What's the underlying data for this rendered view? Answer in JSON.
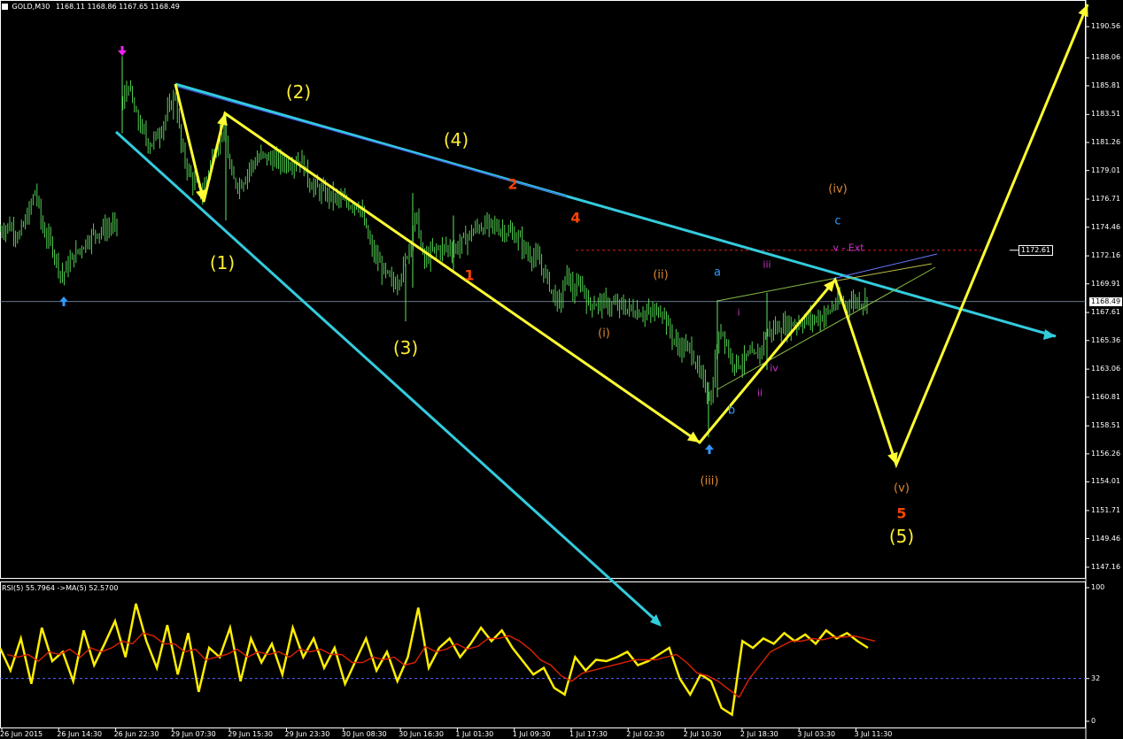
{
  "header": {
    "symbol": "GOLD,M30",
    "ohlc": "1168.11 1168.86 1167.65 1168.49",
    "rsi_title": "RSI(5) 55.7964 ->MA(5) 52.5700"
  },
  "colors": {
    "background": "#000000",
    "candle": "#5ce65c",
    "wave_yellow": "#ffff33",
    "trendline_cyan": "#33ccdd",
    "wave_red": "#ff4400",
    "wave_orange": "#dd8833",
    "wave_blue": "#3399ff",
    "wave_magenta": "#cc33cc",
    "rsi": "#ffee00",
    "rsi_ma": "#dd2200",
    "grid": "#ffffff"
  },
  "chart_data": [
    {
      "type": "candlestick",
      "title": "GOLD,M30",
      "ylim": [
        1146.3,
        1192.7
      ],
      "y_ticks": [
        "1190.56",
        "1188.06",
        "1185.81",
        "1183.51",
        "1181.26",
        "1179.01",
        "1176.71",
        "1174.46",
        "1172.16",
        "1169.91",
        "1167.61",
        "1165.36",
        "1163.06",
        "1160.81",
        "1158.51",
        "1156.26",
        "1154.01",
        "1151.71",
        "1149.46",
        "1147.16"
      ],
      "x_ticks": [
        "26 Jun 2015",
        "26 Jun 14:30",
        "26 Jun 22:30",
        "29 Jun 07:30",
        "29 Jun 15:30",
        "29 Jun 23:30",
        "30 Jun 08:30",
        "30 Jun 16:30",
        "1 Jul 01:30",
        "1 Jul 09:30",
        "1 Jul 17:30",
        "2 Jul 02:30",
        "2 Jul 10:30",
        "2 Jul 18:30",
        "3 Jul 03:30",
        "3 Jul 11:30"
      ],
      "close_path": [
        [
          0,
          1174.2
        ],
        [
          10,
          1174.6
        ],
        [
          22,
          1173.8
        ],
        [
          32,
          1175.5
        ],
        [
          40,
          1177.5
        ],
        [
          48,
          1174.3
        ],
        [
          58,
          1173.1
        ],
        [
          70,
          1170.5
        ],
        [
          80,
          1171.8
        ],
        [
          92,
          1172.9
        ],
        [
          106,
          1174.0
        ],
        [
          122,
          1174.4
        ],
        [
          134,
          1174.7
        ],
        [
          138,
          1184.2
        ],
        [
          145,
          1186.0
        ],
        [
          152,
          1183.6
        ],
        [
          160,
          1182.3
        ],
        [
          168,
          1181.1
        ],
        [
          178,
          1181.8
        ],
        [
          190,
          1183.8
        ],
        [
          198,
          1185.1
        ],
        [
          205,
          1180.7
        ],
        [
          215,
          1178.5
        ],
        [
          228,
          1177.1
        ],
        [
          240,
          1180.2
        ],
        [
          252,
          1182.6
        ],
        [
          262,
          1178.2
        ],
        [
          272,
          1177.9
        ],
        [
          282,
          1179.3
        ],
        [
          295,
          1180.2
        ],
        [
          310,
          1179.8
        ],
        [
          325,
          1179.6
        ],
        [
          340,
          1179.9
        ],
        [
          350,
          1178.0
        ],
        [
          362,
          1177.3
        ],
        [
          375,
          1176.9
        ],
        [
          390,
          1176.4
        ],
        [
          405,
          1176.3
        ],
        [
          420,
          1172.6
        ],
        [
          432,
          1171.0
        ],
        [
          445,
          1169.8
        ],
        [
          455,
          1171.1
        ],
        [
          462,
          1173.0
        ],
        [
          470,
          1175.5
        ],
        [
          478,
          1171.7
        ],
        [
          490,
          1172.6
        ],
        [
          502,
          1172.8
        ],
        [
          515,
          1172.8
        ],
        [
          525,
          1173.5
        ],
        [
          540,
          1174.5
        ],
        [
          555,
          1174.6
        ],
        [
          570,
          1174.2
        ],
        [
          585,
          1173.6
        ],
        [
          595,
          1172.4
        ],
        [
          605,
          1172.0
        ],
        [
          615,
          1170.8
        ],
        [
          625,
          1169.0
        ],
        [
          632,
          1168.2
        ],
        [
          640,
          1170.8
        ],
        [
          648,
          1169.1
        ],
        [
          656,
          1170.1
        ],
        [
          664,
          1168.3
        ],
        [
          675,
          1168.4
        ],
        [
          690,
          1168.2
        ],
        [
          705,
          1168.0
        ],
        [
          720,
          1167.7
        ],
        [
          735,
          1167.5
        ],
        [
          748,
          1167.9
        ],
        [
          755,
          1166.3
        ],
        [
          765,
          1164.9
        ],
        [
          780,
          1164.7
        ],
        [
          790,
          1162.6
        ],
        [
          798,
          1161.5
        ],
        [
          803,
          1160.5
        ],
        [
          808,
          1164.3
        ],
        [
          815,
          1166.5
        ],
        [
          825,
          1163.9
        ],
        [
          835,
          1163.5
        ],
        [
          845,
          1164.1
        ],
        [
          855,
          1164.0
        ],
        [
          865,
          1166.0
        ],
        [
          875,
          1166.3
        ],
        [
          885,
          1166.5
        ],
        [
          895,
          1166.7
        ],
        [
          905,
          1166.9
        ],
        [
          915,
          1167.0
        ],
        [
          925,
          1167.2
        ],
        [
          935,
          1167.6
        ],
        [
          945,
          1168.5
        ],
        [
          955,
          1168.3
        ],
        [
          965,
          1168.6
        ],
        [
          980,
          1168.49
        ]
      ],
      "current_price": "1168.49",
      "marked_level": "1172.61"
    },
    {
      "type": "line",
      "title": "RSI(5) 55.7964 ->MA(5) 52.5700",
      "ylim": [
        0,
        100
      ],
      "y_ticks": [
        "100",
        "32",
        "0"
      ],
      "series": [
        {
          "name": "RSI(5)",
          "values": [
            55,
            38,
            62,
            28,
            70,
            45,
            52,
            30,
            68,
            42,
            58,
            75,
            48,
            88,
            60,
            40,
            72,
            35,
            66,
            22,
            55,
            48,
            70,
            30,
            62,
            44,
            58,
            35,
            70,
            48,
            62,
            40,
            55,
            28,
            45,
            62,
            38,
            52,
            30,
            48,
            85,
            40,
            55,
            62,
            48,
            58,
            70,
            60,
            68,
            55,
            45,
            35,
            40,
            25,
            20,
            48,
            38,
            46,
            45,
            48,
            52,
            42,
            45,
            50,
            55,
            32,
            20,
            35,
            30,
            10,
            5,
            60,
            55,
            62,
            58,
            66,
            60,
            65,
            58,
            68,
            62,
            66,
            60,
            55
          ]
        },
        {
          "name": "MA(5)",
          "values": [
            50,
            48,
            50,
            45,
            52,
            50,
            54,
            48,
            55,
            52,
            55,
            60,
            58,
            66,
            64,
            58,
            58,
            52,
            54,
            46,
            48,
            50,
            54,
            48,
            52,
            50,
            52,
            48,
            54,
            52,
            54,
            50,
            50,
            44,
            44,
            48,
            46,
            48,
            42,
            44,
            56,
            52,
            54,
            58,
            54,
            56,
            62,
            62,
            64,
            60,
            54,
            46,
            42,
            34,
            30,
            36,
            38,
            40,
            42,
            44,
            46,
            46,
            46,
            48,
            50,
            44,
            36,
            34,
            30,
            24,
            18,
            32,
            42,
            52,
            56,
            60,
            60,
            62,
            61,
            63,
            63,
            64,
            62,
            60
          ]
        }
      ],
      "ma_shift_px": 8,
      "levels": [
        32
      ]
    }
  ],
  "annotations": [
    {
      "text": "(2)",
      "color": "#ffee33",
      "size": 20
    },
    {
      "text": "(4)",
      "color": "#ffee33",
      "size": 20
    },
    {
      "text": "(1)",
      "color": "#ffee33",
      "size": 20
    },
    {
      "text": "(3)",
      "color": "#ffee33",
      "size": 20
    },
    {
      "text": "(5)",
      "color": "#ffee33",
      "size": 20
    },
    {
      "text": "2",
      "color": "#ff4400",
      "size": 16
    },
    {
      "text": "4",
      "color": "#ff4400",
      "size": 16
    },
    {
      "text": "1",
      "color": "#ff4400",
      "size": 16
    },
    {
      "text": "5",
      "color": "#ff4400",
      "size": 16
    },
    {
      "text": "(iv)",
      "color": "#dd8833",
      "size": 13
    },
    {
      "text": "(ii)",
      "color": "#dd8833",
      "size": 13
    },
    {
      "text": "(i)",
      "color": "#dd8833",
      "size": 13
    },
    {
      "text": "(iii)",
      "color": "#dd8833",
      "size": 13
    },
    {
      "text": "(v)",
      "color": "#dd8833",
      "size": 13
    },
    {
      "text": "c",
      "color": "#3399ff",
      "size": 13
    },
    {
      "text": "a",
      "color": "#3399ff",
      "size": 13
    },
    {
      "text": "b",
      "color": "#3399ff",
      "size": 13
    },
    {
      "text": "v - Ext",
      "color": "#cc33cc",
      "size": 11
    },
    {
      "text": "iii",
      "color": "#cc33cc",
      "size": 11
    },
    {
      "text": "i",
      "color": "#cc33cc",
      "size": 11
    },
    {
      "text": "iv",
      "color": "#cc33cc",
      "size": 11
    },
    {
      "text": "ii",
      "color": "#cc33cc",
      "size": 11
    }
  ]
}
